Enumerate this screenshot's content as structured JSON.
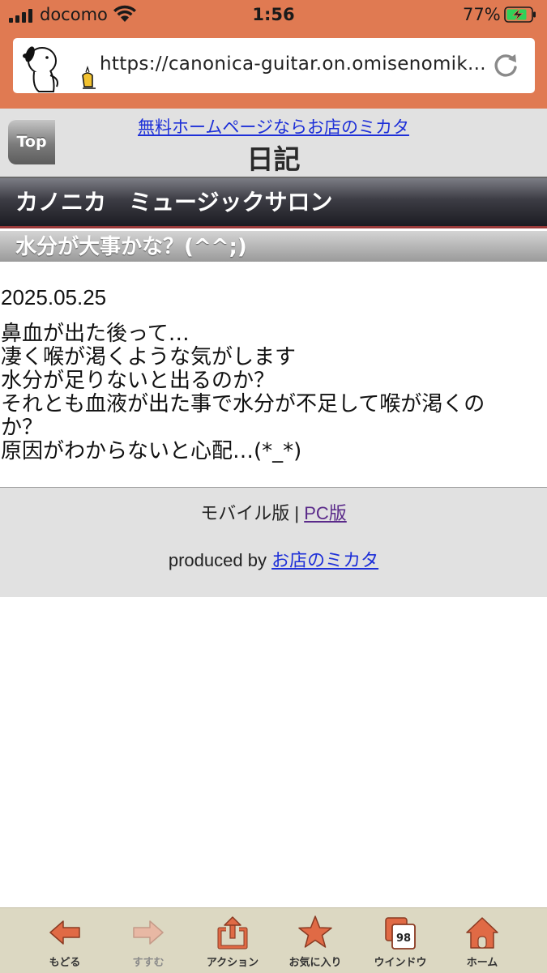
{
  "status_bar": {
    "carrier": "docomo",
    "time": "1:56",
    "battery_percent": "77%",
    "signal_bars": 4
  },
  "browser": {
    "url": "https://canonica-guitar.on.omisenomikata.jp/",
    "url_display": "https://canonica-guitar.on.omisenomik..."
  },
  "header": {
    "top_button": "Top",
    "ad_link": "無料ホームページならお店のミカタ",
    "page_title": "日記"
  },
  "site": {
    "name": "カノニカ　ミュージックサロン"
  },
  "entry": {
    "title": "水分が大事かな？(^^;)",
    "date": "2025.05.25",
    "lines": [
      "鼻血が出た後って…",
      "凄く喉が渇くような気がします",
      "水分が足りないと出るのか？",
      "それとも血液が出た事で水分が不足して喉が渇くの",
      "か？",
      "原因がわからないと心配…(*_*)"
    ]
  },
  "footer": {
    "mobile_label": "モバイル版",
    "separator": "|",
    "pc_link": "PC版",
    "produced_by": "produced by",
    "mikata_link": "お店のミカタ"
  },
  "toolbar": {
    "back": "もどる",
    "forward": "すすむ",
    "action": "アクション",
    "favorites": "お気に入り",
    "windows": "ウインドウ",
    "windows_count": "98",
    "home": "ホーム"
  },
  "colors": {
    "header_bg": "#E07A52",
    "toolbar_icon": "#E06A45",
    "link_blue": "#1d2fd8",
    "visited_purple": "#5a2a8a"
  }
}
